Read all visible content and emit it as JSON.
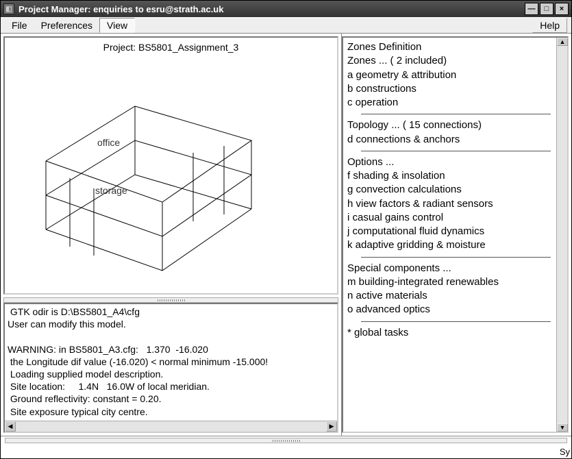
{
  "window": {
    "title": "Project Manager: enquiries to esru@strath.ac.uk"
  },
  "menubar": {
    "file": "File",
    "preferences": "Preferences",
    "view": "View",
    "help": "Help"
  },
  "viewport": {
    "project_title": "Project: BS5801_Assignment_3",
    "zone_labels": {
      "office": "office",
      "storage": "storage"
    }
  },
  "console": {
    "lines": [
      " GTK odir is D:\\BS5801_A4\\cfg",
      "User can modify this model.",
      "",
      "WARNING: in BS5801_A3.cfg:   1.370  -16.020",
      " the Longitude dif value (-16.020) < normal minimum -15.000!",
      " Loading supplied model description.",
      " Site location:     1.4N   16.0W of local meridian.",
      " Ground reflectivity: constant = 0.20.",
      " Site exposure typical city centre."
    ]
  },
  "side": {
    "heading_zones": "Zones Definition",
    "zones_line": " Zones ...   (  2 included)",
    "a": "a  geometry & attribution",
    "b": "b  constructions",
    "c": "c  operation",
    "topology_line": " Topology ... ( 15 connections)",
    "d": "d  connections & anchors",
    "options_line": " Options ...",
    "f": "f  shading & insolation",
    "g": "g  convection calculations",
    "h": "h  view factors & radiant sensors",
    "i": "i  casual gains control",
    "j": "j  computational fluid dynamics",
    "k": "k  adaptive gridding & moisture",
    "special_line": " Special components ...",
    "m": "m  building-integrated renewables",
    "n": "n  active materials",
    "o": "o  advanced optics",
    "global": "*  global tasks"
  },
  "status": {
    "corner": "Sy"
  }
}
